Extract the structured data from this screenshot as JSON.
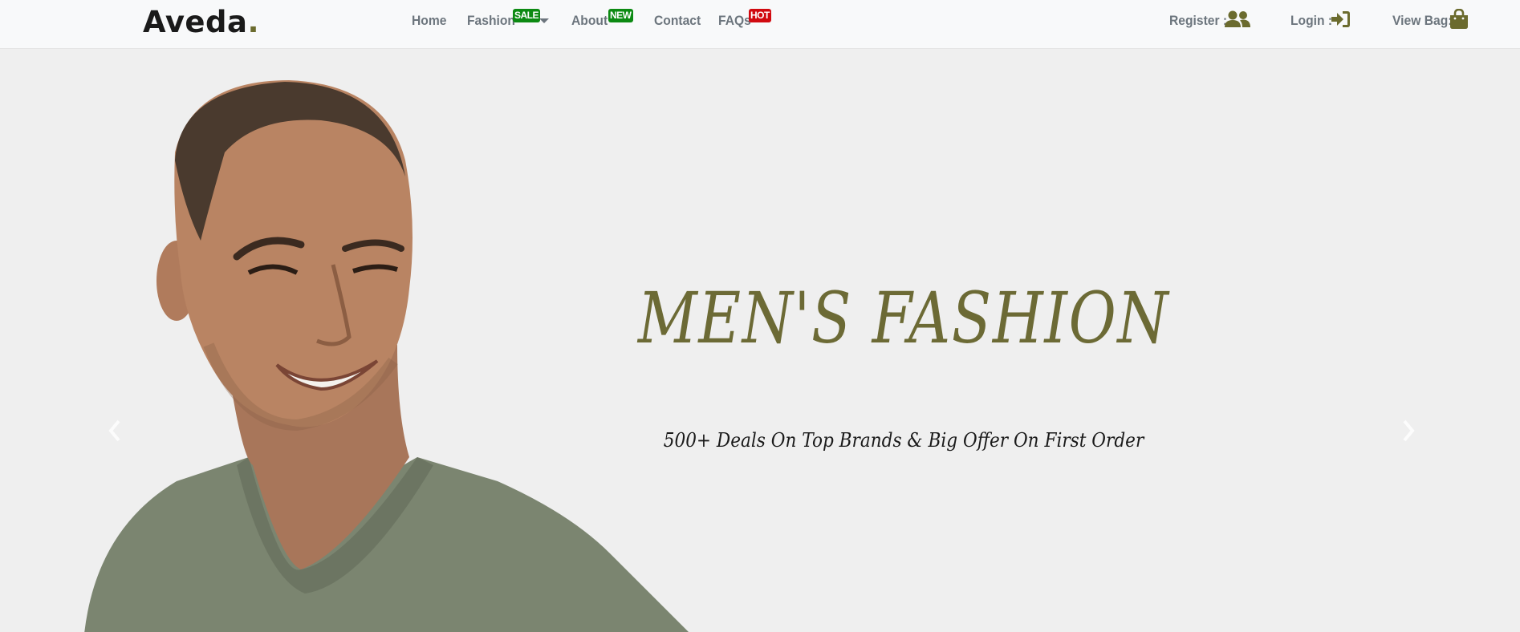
{
  "brand": {
    "name": "Aveda",
    "dot": "."
  },
  "nav": {
    "home": "Home",
    "fashion": "Fashion",
    "fashion_badge": "SALE",
    "about": "About",
    "about_badge": "NEW",
    "contact": "Contact",
    "faqs": "FAQs",
    "faqs_badge": "HOT",
    "register": "Register :",
    "login": "Login :",
    "view_bag": "View Bag:"
  },
  "hero": {
    "title": "MEN'S FASHION",
    "subtitle": "500+ Deals On Top Brands & Big Offer On First Order"
  },
  "colors": {
    "accent": "#6b6b2e",
    "nav_text": "#6c757d",
    "badge_green": "#0c8a12",
    "badge_red": "#d10a10",
    "hero_bg": "#efefef"
  },
  "icons": [
    "users-icon",
    "sign-in-icon",
    "shopping-bag-icon",
    "chevron-left-icon",
    "chevron-right-icon",
    "caret-down-icon"
  ]
}
